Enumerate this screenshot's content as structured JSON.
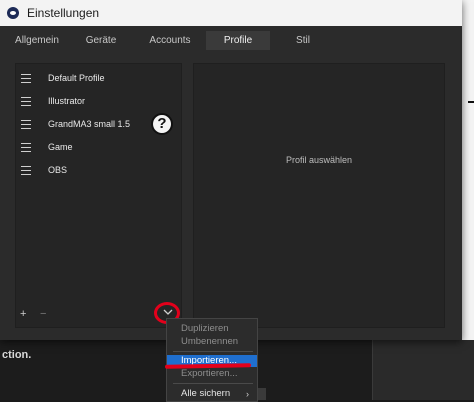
{
  "window": {
    "title": "Einstellungen"
  },
  "tabs": [
    {
      "label": "Allgemein",
      "active": false
    },
    {
      "label": "Geräte",
      "active": false
    },
    {
      "label": "Accounts",
      "active": false
    },
    {
      "label": "Profile",
      "active": true
    },
    {
      "label": "Stil",
      "active": false
    }
  ],
  "profiles": [
    {
      "label": "Default Profile"
    },
    {
      "label": "Illustrator"
    },
    {
      "label": "GrandMA3 small 1.5"
    },
    {
      "label": "Game"
    },
    {
      "label": "OBS"
    }
  ],
  "help_icon": {
    "glyph": "?"
  },
  "detail": {
    "placeholder": "Profil auswählen"
  },
  "list_actions": {
    "add": "+",
    "remove": "−",
    "dropdown": "chevron-down-icon"
  },
  "menu": {
    "items": [
      {
        "label": "Duplizieren",
        "enabled": false
      },
      {
        "label": "Umbenennen",
        "enabled": false
      },
      {
        "label": "Importieren...",
        "enabled": true,
        "highlighted": true
      },
      {
        "label": "Exportieren...",
        "enabled": false
      },
      {
        "label": "Alle sichern",
        "enabled": true,
        "has_submenu": true
      }
    ],
    "submenu_arrow": "›"
  },
  "background": {
    "fragment_text": "ction."
  },
  "colors": {
    "highlight": "#1f6fcf",
    "annotation_red": "#e3001b"
  }
}
